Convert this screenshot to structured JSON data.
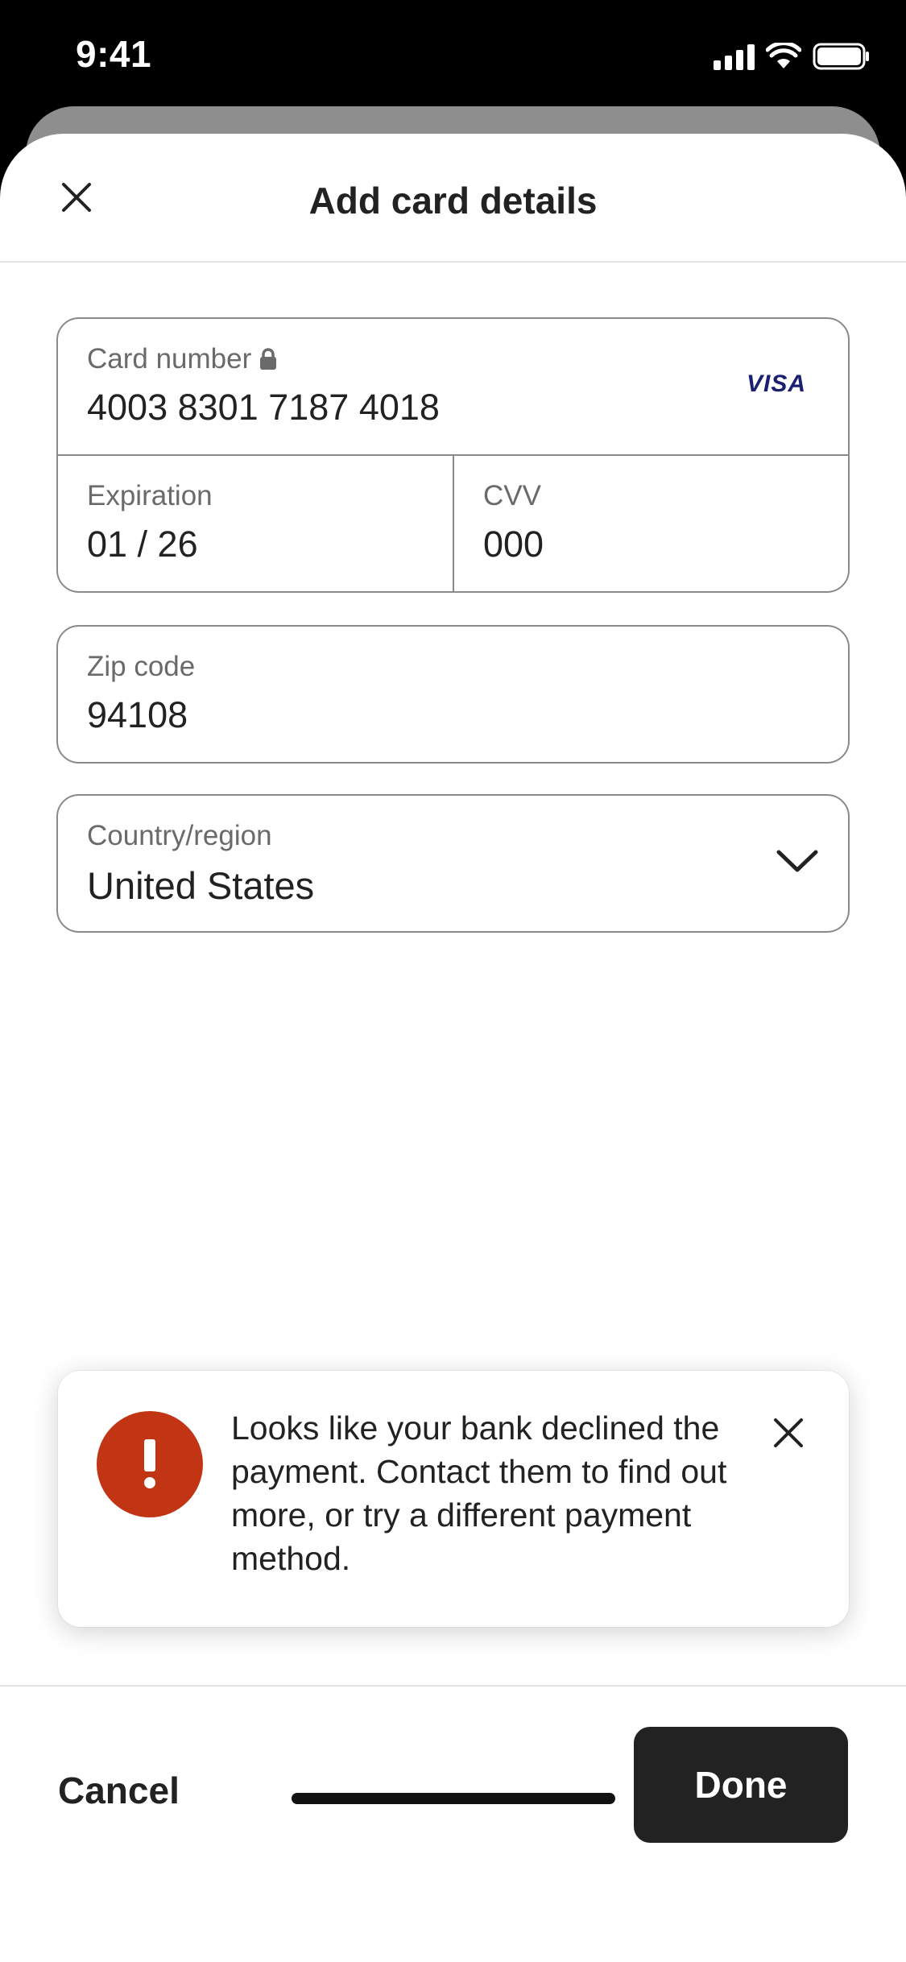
{
  "status_bar": {
    "time": "9:41",
    "icons": [
      "cellular-signal-icon",
      "wifi-icon",
      "battery-icon"
    ]
  },
  "header": {
    "title": "Add card details",
    "close_icon": "close-icon"
  },
  "card": {
    "number_label": "Card number",
    "number_value": "4003 8301 7187 4018",
    "brand": "VISA",
    "lock_icon": "lock-icon",
    "expiration_label": "Expiration",
    "expiration_value": "01 / 26",
    "cvv_label": "CVV",
    "cvv_value": "000"
  },
  "zip": {
    "label": "Zip code",
    "value": "94108"
  },
  "country": {
    "label": "Country/region",
    "value": "United States",
    "icon": "chevron-down-icon"
  },
  "toast": {
    "message": "Looks like your bank declined the payment. Contact them to find out more, or try a different payment method.",
    "icon": "alert-icon",
    "close_icon": "close-icon"
  },
  "footer": {
    "cancel_label": "Cancel",
    "done_label": "Done"
  },
  "colors": {
    "error": "#c13515",
    "primary_button": "#222222",
    "border": "#8a8a8a",
    "visa_blue": "#1a1f71"
  }
}
